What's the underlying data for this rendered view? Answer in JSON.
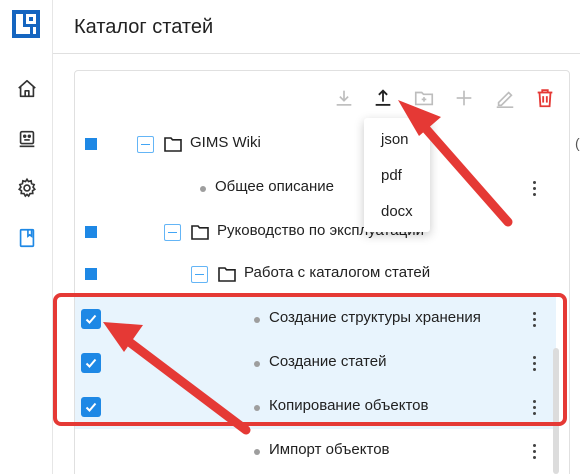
{
  "header": {
    "title": "Каталог статей"
  },
  "sidebar": {
    "items": [
      {
        "name": "home",
        "icon": "home-icon"
      },
      {
        "name": "robot",
        "icon": "robot-icon"
      },
      {
        "name": "settings",
        "icon": "gear-icon"
      },
      {
        "name": "catalog",
        "icon": "book-icon",
        "active": true
      }
    ]
  },
  "toolbar": {
    "buttons": [
      {
        "name": "import",
        "icon": "download-icon",
        "enabled": false
      },
      {
        "name": "export",
        "icon": "upload-icon",
        "enabled": true
      },
      {
        "name": "add-folder",
        "icon": "folder-plus-icon",
        "enabled": false
      },
      {
        "name": "add",
        "icon": "plus-icon",
        "enabled": false
      },
      {
        "name": "edit",
        "icon": "pencil-icon",
        "enabled": false
      },
      {
        "name": "delete",
        "icon": "trash-icon",
        "enabled": true
      }
    ]
  },
  "export_menu": {
    "options": [
      "json",
      "pdf",
      "docx"
    ]
  },
  "tree": {
    "rows": [
      {
        "label": "GIMS Wiki",
        "type": "folder",
        "marker": "square"
      },
      {
        "label": "Общее описание",
        "type": "article",
        "marker": "none"
      },
      {
        "label": "Руководство по эксплуатации",
        "type": "folder",
        "marker": "square"
      },
      {
        "label": "Работа с каталогом статей",
        "type": "folder",
        "marker": "square"
      },
      {
        "label": "Создание структуры хранения",
        "type": "article",
        "marker": "checked"
      },
      {
        "label": "Создание статей",
        "type": "article",
        "marker": "checked"
      },
      {
        "label": "Копирование объектов",
        "type": "article",
        "marker": "checked"
      },
      {
        "label": "Импорт объектов",
        "type": "article",
        "marker": "none"
      }
    ]
  },
  "colors": {
    "accent": "#1e88e5",
    "selected_row": "#e8f4fd",
    "annotation": "#e53935",
    "delete": "#e53935"
  }
}
